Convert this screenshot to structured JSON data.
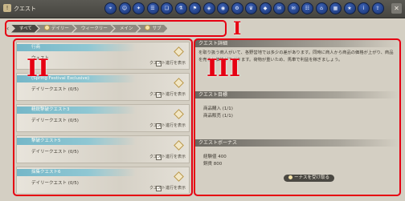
{
  "window": {
    "title": "クエスト",
    "close_glyph": "✕"
  },
  "toolbar": {
    "icons": [
      "map-icon",
      "person-icon",
      "skill-icon",
      "menu-icon",
      "book-icon",
      "potion-icon",
      "flag-icon",
      "bag-icon",
      "camera-icon",
      "gear-icon",
      "trophy-icon",
      "cube-icon",
      "chat-icon",
      "mail-icon",
      "list-icon",
      "home-icon",
      "calendar-icon",
      "star-icon",
      "info-icon",
      "share-icon"
    ]
  },
  "tabs": [
    {
      "label": "すべて",
      "active": true,
      "dot": false
    },
    {
      "label": "デイリー",
      "active": false,
      "dot": true
    },
    {
      "label": "ウィークリー",
      "active": false,
      "dot": false
    },
    {
      "label": "メイン",
      "active": false,
      "dot": false
    },
    {
      "label": "サブ",
      "active": false,
      "dot": true
    }
  ],
  "markers": {
    "one": "I",
    "two": "II",
    "three": "III"
  },
  "quests": [
    {
      "title": "行商",
      "subtitle": "ウェスト",
      "status": "クエスト進行を表示"
    },
    {
      "title": "(Spring Festival Exclusive)",
      "subtitle": "デイリークエスト (0/5)",
      "status": "クエスト進行を表示"
    },
    {
      "title": "精鋭撃破クエスト3",
      "subtitle": "デイリークエスト (0/5)",
      "status": "クエスト進行を表示"
    },
    {
      "title": "撃破クエスト5",
      "subtitle": "デイリークエスト (0/5)",
      "status": "クエスト進行を表示"
    },
    {
      "title": "採集クエスト6",
      "subtitle": "デイリークエスト (0/5)",
      "status": "クエスト進行を表示"
    }
  ],
  "detail": {
    "detail_heading": "クエスト詳細",
    "detail_text": "を取り扱う商人がいて、各野営地では多少の差があります。同時に商人から商品の価格が上がり、商品を売ると価格が下がります。荷物が重いため、馬車で利益を稼ぎましょう。",
    "objective_heading": "クエスト目標",
    "objectives": [
      "商品購入 (1/1)",
      "商品販売 (1/1)"
    ],
    "bonus_heading": "クエストボーナス",
    "bonuses": [
      "経験値 400",
      "銅貨 800"
    ],
    "show_button": "ーナスを受け取る"
  }
}
